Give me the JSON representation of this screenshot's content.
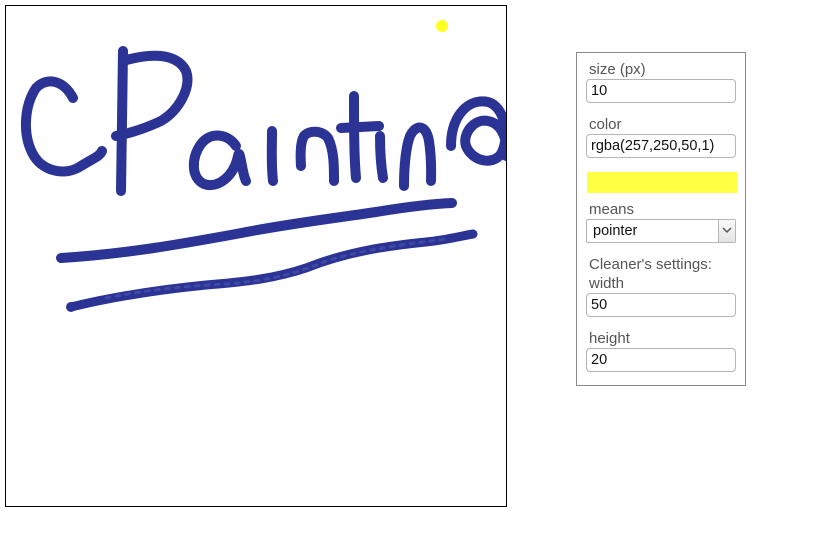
{
  "canvas": {
    "stroke_color": "#2b3394",
    "pointer_color": "#ffff22"
  },
  "settings": {
    "size_label": "size (px)",
    "size_value": "10",
    "color_label": "color",
    "color_value": "rgba(257,250,50,1)",
    "swatch_color": "#ffff44",
    "means_label": "means",
    "means_value": "pointer",
    "cleaner_label": "Cleaner's settings:",
    "width_label": "width",
    "width_value": "50",
    "height_label": "height",
    "height_value": "20"
  }
}
